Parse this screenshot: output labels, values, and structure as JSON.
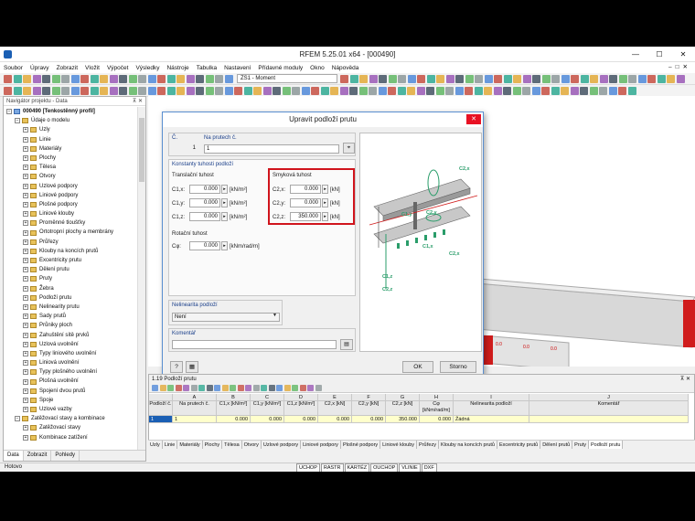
{
  "window": {
    "title": "RFEM 5.25.01 x64 - [000490]"
  },
  "menu": [
    "Soubor",
    "Úpravy",
    "Zobrazit",
    "Vložit",
    "Výpočet",
    "Výsledky",
    "Nástroje",
    "Tabulka",
    "Nastavení",
    "Přídavné moduly",
    "Okno",
    "Nápověda"
  ],
  "toolbar": {
    "loadcase_combo": "ZS1 - Moment"
  },
  "navigator": {
    "header": "Navigátor projektu - Data",
    "items": [
      {
        "label": "000490 [Tenkostěnný profil]",
        "level": 0,
        "bold": true
      },
      {
        "label": "Údaje o modelu",
        "level": 1
      },
      {
        "label": "Uzly",
        "level": 2
      },
      {
        "label": "Linie",
        "level": 2
      },
      {
        "label": "Materiály",
        "level": 2
      },
      {
        "label": "Plochy",
        "level": 2
      },
      {
        "label": "Tělesa",
        "level": 2
      },
      {
        "label": "Otvory",
        "level": 2
      },
      {
        "label": "Uzlové podpory",
        "level": 2
      },
      {
        "label": "Liniové podpory",
        "level": 2
      },
      {
        "label": "Plošné podpory",
        "level": 2
      },
      {
        "label": "Liniové klouby",
        "level": 2
      },
      {
        "label": "Proměnné tloušťky",
        "level": 2
      },
      {
        "label": "Ortotropní plochy a membrány",
        "level": 2
      },
      {
        "label": "Průřezy",
        "level": 2
      },
      {
        "label": "Klouby na koncích prutů",
        "level": 2
      },
      {
        "label": "Excentricity prutu",
        "level": 2
      },
      {
        "label": "Dělení prutu",
        "level": 2
      },
      {
        "label": "Pruty",
        "level": 2
      },
      {
        "label": "Žebra",
        "level": 2
      },
      {
        "label": "Podloží prutu",
        "level": 2
      },
      {
        "label": "Nelinearity prutu",
        "level": 2
      },
      {
        "label": "Sady prutů",
        "level": 2
      },
      {
        "label": "Průniky ploch",
        "level": 2
      },
      {
        "label": "Zahuštění sítě prvků",
        "level": 2
      },
      {
        "label": "Uzlová uvolnění",
        "level": 2
      },
      {
        "label": "Typy liniového uvolnění",
        "level": 2
      },
      {
        "label": "Liniová uvolnění",
        "level": 2
      },
      {
        "label": "Typy plošného uvolnění",
        "level": 2
      },
      {
        "label": "Plošná uvolnění",
        "level": 2
      },
      {
        "label": "Spojení dvou prutů",
        "level": 2
      },
      {
        "label": "Spoje",
        "level": 2
      },
      {
        "label": "Uzlové vazby",
        "level": 2
      },
      {
        "label": "Zatěžovací stavy a kombinace",
        "level": 1
      },
      {
        "label": "Zatěžovací stavy",
        "level": 2
      },
      {
        "label": "Kombinace zatížení",
        "level": 2
      }
    ],
    "tabs": [
      "Data",
      "Zobrazit",
      "Pohledy"
    ]
  },
  "dialog": {
    "title": "Upravit podloží prutu",
    "no_label": "Č.",
    "no_value": "1",
    "on_members_label": "Na prutech č.",
    "on_members_value": "1",
    "constants_group": "Konstanty tuhosti podloží",
    "translational_label": "Translační tuhost",
    "shear_label": "Smyková tuhost",
    "c1x_label": "C1,x:",
    "c1x_value": "0.000",
    "c1x_unit": "[kN/m²]",
    "c1y_label": "C1,y:",
    "c1y_value": "0.000",
    "c1y_unit": "[kN/m²]",
    "c1z_label": "C1,z:",
    "c1z_value": "0.000",
    "c1z_unit": "[kN/m²]",
    "c2x_label": "C2,x:",
    "c2x_value": "0.000",
    "c2x_unit": "[kN]",
    "c2y_label": "C2,y:",
    "c2y_value": "0.000",
    "c2y_unit": "[kN]",
    "c2z_label": "C2,z:",
    "c2z_value": "350.000",
    "c2z_unit": "[kN]",
    "rotational_label": "Rotační tuhost",
    "cphi_label": "Cφ:",
    "cphi_value": "0.000",
    "cphi_unit": "[kNm/rad/m]",
    "nonlinearity_group": "Nelinearita podloží",
    "nonlinearity_value": "Není",
    "comment_group": "Komentář",
    "comment_value": "",
    "ok": "OK",
    "cancel": "Storno",
    "preview_labels": [
      "C2,x",
      "C1,y",
      "C2,y",
      "C1,x",
      "C2,x",
      "C1,z",
      "C2,z",
      "C1,z",
      "C2,z"
    ]
  },
  "table": {
    "header": "1.19 Podloží prutu",
    "col_letters": [
      "",
      "A",
      "B",
      "C",
      "D",
      "E",
      "F",
      "G",
      "H",
      "I",
      "J"
    ],
    "col_headers": [
      "Podloží č.",
      "Na prutech č.",
      "C1,x [kN/m²]",
      "C1,y [kN/m²]",
      "C1,z [kN/m²]",
      "C2,x [kN]",
      "C2,y [kN]",
      "C2,z [kN]",
      "Cφ [kNm/rad/m]",
      "Nelinearita podloží",
      "Komentář"
    ],
    "rows": [
      [
        "1",
        "1",
        "0.000",
        "0.000",
        "0.000",
        "0.000",
        "0.000",
        "350.000",
        "0.000",
        "Žádná",
        ""
      ]
    ]
  },
  "sheet_tabs": [
    "Uzly",
    "Linie",
    "Materiály",
    "Plochy",
    "Tělesa",
    "Otvory",
    "Uzlové podpory",
    "Liniové podpory",
    "Plošné podpory",
    "Liniové klouby",
    "Průřezy",
    "Klouby na koncích prutů",
    "Excentricity prutů",
    "Dělení prutů",
    "Pruty",
    "Podloží prutu"
  ],
  "statusbar": {
    "left": "Hotovo",
    "buttons": [
      "UCHOP",
      "RASTR",
      "KARTÉZ",
      "OUCHOP",
      "VLINIE",
      "DXF"
    ]
  },
  "colors": {
    "accent": "#1a5fb4",
    "highlight": "#d0141c",
    "selected_row": "#ffffcc"
  }
}
